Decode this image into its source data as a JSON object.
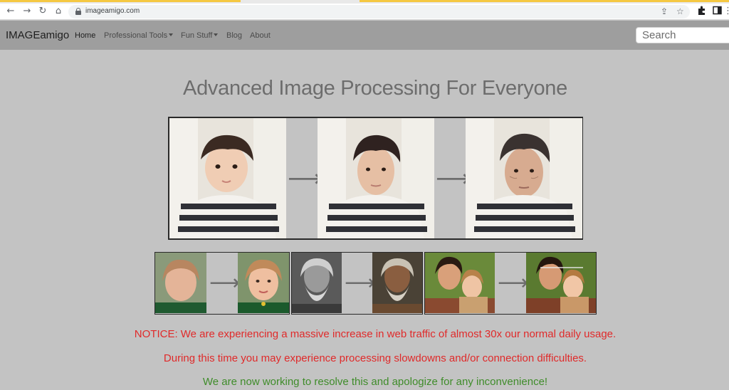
{
  "browser": {
    "url": "imageamigo.com",
    "icons": {
      "back": "arrow-left-icon",
      "forward": "arrow-right-icon",
      "reload": "reload-icon",
      "home": "home-icon",
      "lock": "lock-icon",
      "share": "share-icon",
      "bookmark": "star-icon",
      "extensions": "puzzle-icon",
      "sidepanel": "sidepanel-icon",
      "menu": "kebab-menu-icon"
    }
  },
  "navbar": {
    "brand": "IMAGEamigo",
    "links": [
      {
        "label": "Home",
        "active": true
      },
      {
        "label": "Professional Tools",
        "dropdown": true
      },
      {
        "label": "Fun Stuff",
        "dropdown": true
      },
      {
        "label": "Blog"
      },
      {
        "label": "About"
      }
    ],
    "search_placeholder": "Search"
  },
  "main": {
    "headline": "Advanced Image Processing For Everyone",
    "notices": [
      {
        "text": "NOTICE: We are experiencing a massive increase in web traffic of almost 30x our normal daily usage.",
        "color": "#e02a2a"
      },
      {
        "text": "During this time you may experience processing slowdowns and/or connection difficulties.",
        "color": "#e02a2a"
      },
      {
        "text": "We are now working to resolve this and apologize for any inconvenience!",
        "color": "#3f8c2a"
      }
    ]
  },
  "colors": {
    "page_bg": "#c3c3c3",
    "navbar_bg": "#9e9e9e",
    "headline": "#6d6d6d",
    "notice_red": "#e02a2a",
    "notice_green": "#3f8c2a"
  }
}
